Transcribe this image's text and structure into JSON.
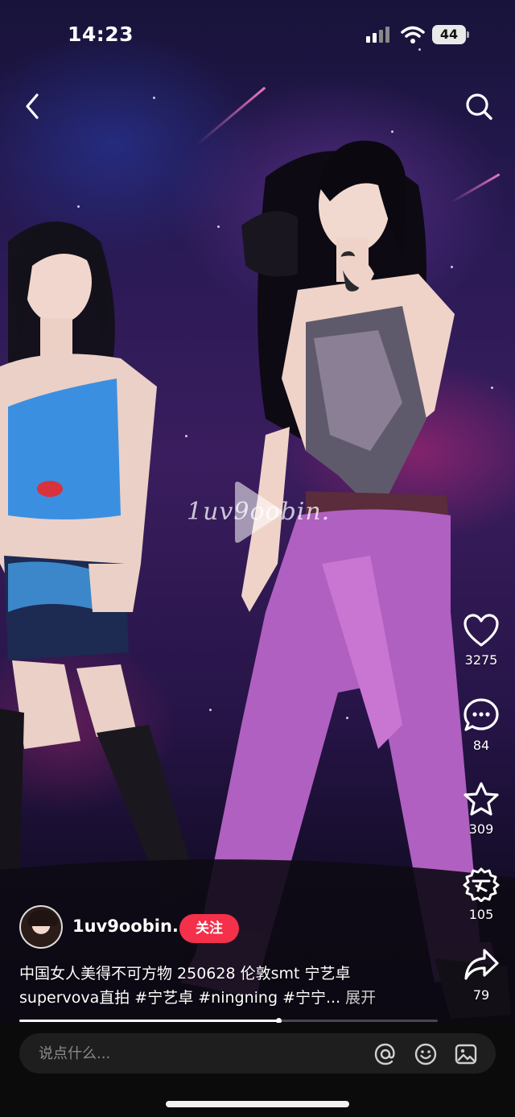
{
  "status_bar": {
    "time": "14:23",
    "battery_level": "44"
  },
  "video": {
    "watermark": "1uv9oobin.",
    "progress_fraction": 0.62
  },
  "author": {
    "name": "1uv9oobin.",
    "follow_label": "关注"
  },
  "caption": {
    "line1": "中国女人美得不可方物 250628 伦敦smt 宁艺卓",
    "line2": "supervova直拍 #宁艺卓  #ningning  #宁宁...",
    "expand_label": "展开"
  },
  "actions": {
    "like_count": "3275",
    "comment_count": "84",
    "favorite_count": "309",
    "share_count": "105",
    "forward_count": "79"
  },
  "comment_bar": {
    "placeholder": "说点什么..."
  },
  "icons": {
    "back": "chevron-left-icon",
    "search": "search-icon",
    "play": "play-icon",
    "like": "heart-icon",
    "comment": "chat-bubble-icon",
    "favorite": "star-icon",
    "share": "share-badge-icon",
    "forward": "forward-arrow-icon",
    "mention": "at-sign-icon",
    "emoji": "smile-icon",
    "image": "image-icon"
  },
  "colors": {
    "follow_button": "#f4304a",
    "background": "#000000"
  }
}
